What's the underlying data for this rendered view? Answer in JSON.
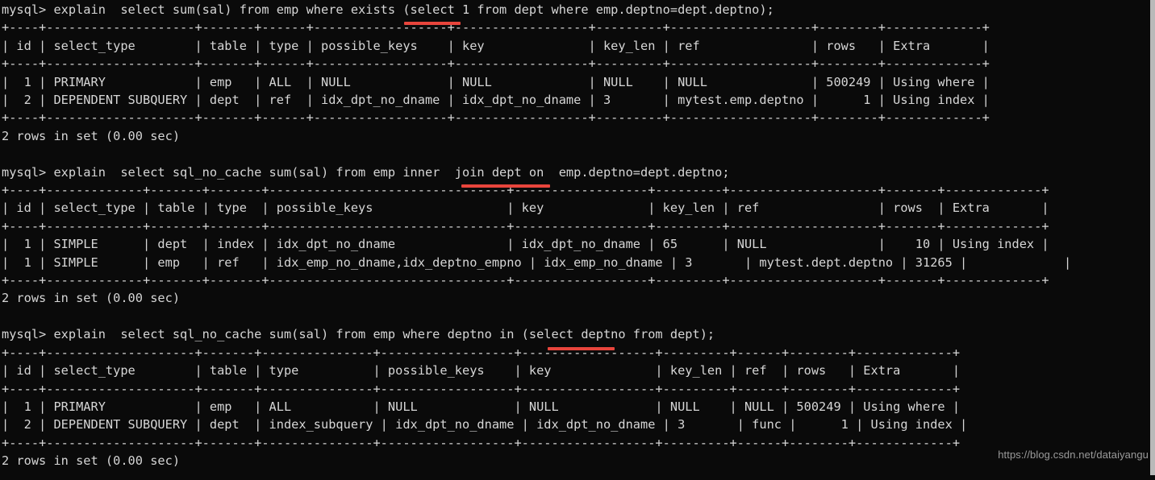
{
  "terminal": {
    "background_color": "#0a0a0a",
    "text_color": "#d6d6d6",
    "highlight_color": "#e8453c",
    "watermark": "https://blog.csdn.net/dataiyangu"
  },
  "blocks": [
    {
      "id": "block-exists",
      "prompt": "mysql>",
      "query": "mysql> explain  select sum(sal) from emp where exists (select 1 from dept where emp.deptno=dept.deptno);",
      "highlight_keyword": "exists",
      "table": {
        "border": "+----+--------------------+-------+------+------------------+------------------+---------+-------------------+--------+-------------+",
        "header": "| id | select_type        | table | type | possible_keys    | key              | key_len | ref               | rows   | Extra       |",
        "rows": [
          "|  1 | PRIMARY            | emp   | ALL  | NULL             | NULL             | NULL    | NULL              | 500249 | Using where |",
          "|  2 | DEPENDENT SUBQUERY | dept  | ref  | idx_dpt_no_dname | idx_dpt_no_dname | 3       | mytest.emp.deptno |      1 | Using index |"
        ],
        "columns": [
          "id",
          "select_type",
          "table",
          "type",
          "possible_keys",
          "key",
          "key_len",
          "ref",
          "rows",
          "Extra"
        ],
        "data": [
          {
            "id": "1",
            "select_type": "PRIMARY",
            "table": "emp",
            "type": "ALL",
            "possible_keys": "NULL",
            "key": "NULL",
            "key_len": "NULL",
            "ref": "NULL",
            "rows": "500249",
            "Extra": "Using where"
          },
          {
            "id": "2",
            "select_type": "DEPENDENT SUBQUERY",
            "table": "dept",
            "type": "ref",
            "possible_keys": "idx_dpt_no_dname",
            "key": "idx_dpt_no_dname",
            "key_len": "3",
            "ref": "mytest.emp.deptno",
            "rows": "1",
            "Extra": "Using index"
          }
        ]
      },
      "result": "2 rows in set (0.00 sec)"
    },
    {
      "id": "block-inner-join",
      "prompt": "mysql>",
      "query": "mysql> explain  select sql_no_cache sum(sal) from emp inner  join dept on  emp.deptno=dept.deptno;",
      "highlight_keyword": "inner  join",
      "table": {
        "border": "+----+-------------+-------+-------+--------------------------------+------------------+---------+--------------------+-------+-------------+",
        "header": "| id | select_type | table | type  | possible_keys                  | key              | key_len | ref                | rows  | Extra       |",
        "rows": [
          "|  1 | SIMPLE      | dept  | index | idx_dpt_no_dname               | idx_dpt_no_dname | 65      | NULL               |    10 | Using index |",
          "|  1 | SIMPLE      | emp   | ref   | idx_emp_no_dname,idx_deptno_empno | idx_emp_no_dname | 3       | mytest.dept.deptno | 31265 |             |"
        ],
        "columns": [
          "id",
          "select_type",
          "table",
          "type",
          "possible_keys",
          "key",
          "key_len",
          "ref",
          "rows",
          "Extra"
        ],
        "data": [
          {
            "id": "1",
            "select_type": "SIMPLE",
            "table": "dept",
            "type": "index",
            "possible_keys": "idx_dpt_no_dname",
            "key": "idx_dpt_no_dname",
            "key_len": "65",
            "ref": "NULL",
            "rows": "10",
            "Extra": "Using index"
          },
          {
            "id": "1",
            "select_type": "SIMPLE",
            "table": "emp",
            "type": "ref",
            "possible_keys": "idx_emp_no_dname,idx_deptno_empno",
            "key": "idx_emp_no_dname",
            "key_len": "3",
            "ref": "mytest.dept.deptno",
            "rows": "31265",
            "Extra": ""
          }
        ]
      },
      "result": "2 rows in set (0.00 sec)"
    },
    {
      "id": "block-in-subquery",
      "prompt": "mysql>",
      "query": "mysql> explain  select sql_no_cache sum(sal) from emp where deptno in (select deptno from dept);",
      "highlight_keyword": "in",
      "table": {
        "border": "+----+--------------------+-------+---------------+------------------+------------------+---------+------+--------+-------------+",
        "header": "| id | select_type        | table | type          | possible_keys    | key              | key_len | ref  | rows   | Extra       |",
        "rows": [
          "|  1 | PRIMARY            | emp   | ALL           | NULL             | NULL             | NULL    | NULL | 500249 | Using where |",
          "|  2 | DEPENDENT SUBQUERY | dept  | index_subquery | idx_dpt_no_dname | idx_dpt_no_dname | 3       | func |      1 | Using index |"
        ],
        "columns": [
          "id",
          "select_type",
          "table",
          "type",
          "possible_keys",
          "key",
          "key_len",
          "ref",
          "rows",
          "Extra"
        ],
        "data": [
          {
            "id": "1",
            "select_type": "PRIMARY",
            "table": "emp",
            "type": "ALL",
            "possible_keys": "NULL",
            "key": "NULL",
            "key_len": "NULL",
            "ref": "NULL",
            "rows": "500249",
            "Extra": "Using where"
          },
          {
            "id": "2",
            "select_type": "DEPENDENT SUBQUERY",
            "table": "dept",
            "type": "index_subquery",
            "possible_keys": "idx_dpt_no_dname",
            "key": "idx_dpt_no_dname",
            "key_len": "3",
            "ref": "func",
            "rows": "1",
            "Extra": "Using index"
          }
        ]
      },
      "result": "2 rows in set (0.00 sec)"
    }
  ]
}
